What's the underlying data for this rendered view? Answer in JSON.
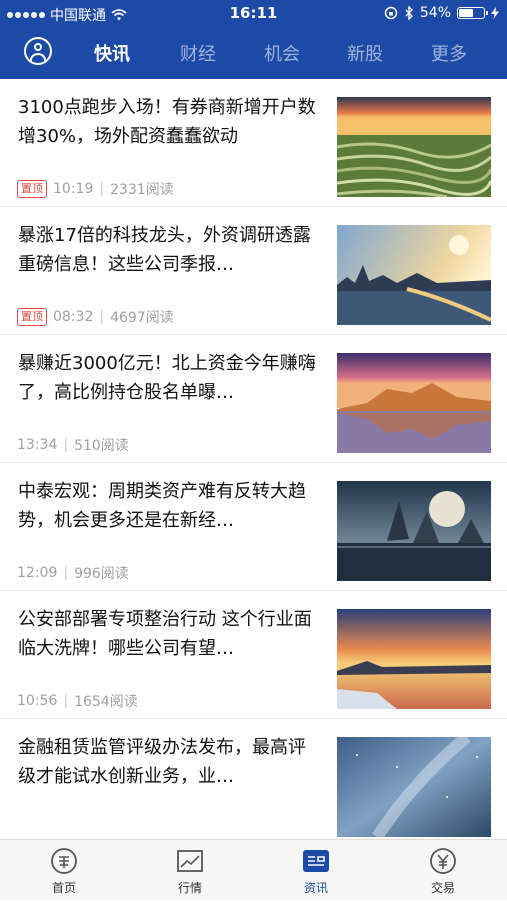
{
  "status_bar": {
    "carrier": "中国联通",
    "time": "16:11",
    "battery": "54%"
  },
  "nav": {
    "tabs": [
      {
        "label": "快讯",
        "active": true
      },
      {
        "label": "财经",
        "active": false
      },
      {
        "label": "机会",
        "active": false
      },
      {
        "label": "新股",
        "active": false
      },
      {
        "label": "更多",
        "active": false
      }
    ]
  },
  "feed": [
    {
      "title": "3100点跑步入场！有券商新增开户数增30%，场外配资蠢蠢欲动",
      "pinned": true,
      "pin_label": "置顶",
      "time": "10:19",
      "reads": "2331阅读",
      "image": "terraced-fields-sunset"
    },
    {
      "title": "暴涨17倍的科技龙头，外资调研透露重磅信息！这些公司季报…",
      "pinned": true,
      "pin_label": "置顶",
      "time": "08:32",
      "reads": "4697阅读",
      "image": "city-bridge-sunset"
    },
    {
      "title": "暴赚近3000亿元！北上资金今年赚嗨了，高比例持仓股名单曝…",
      "pinned": false,
      "time": "13:34",
      "reads": "510阅读",
      "image": "desert-mesa-reflection"
    },
    {
      "title": "中泰宏观：周期类资产难有反转大趋势，机会更多还是在新经…",
      "pinned": false,
      "time": "12:09",
      "reads": "996阅读",
      "image": "moon-rocks-sea"
    },
    {
      "title": "公安部部署专项整治行动 这个行业面临大洗牌！哪些公司有望…",
      "pinned": false,
      "time": "10:56",
      "reads": "1654阅读",
      "image": "fiery-sunset-lake"
    },
    {
      "title": "金融租赁监管评级办法发布，最高评级才能试水创新业务，业…",
      "pinned": false,
      "time": "",
      "reads": "",
      "image": "milky-way-night"
    }
  ],
  "tabbar": [
    {
      "label": "首页",
      "icon": "coupon-icon",
      "active": false
    },
    {
      "label": "行情",
      "icon": "chart-icon",
      "active": false
    },
    {
      "label": "资讯",
      "icon": "news-icon",
      "active": true
    },
    {
      "label": "交易",
      "icon": "yuan-icon",
      "active": false
    }
  ]
}
